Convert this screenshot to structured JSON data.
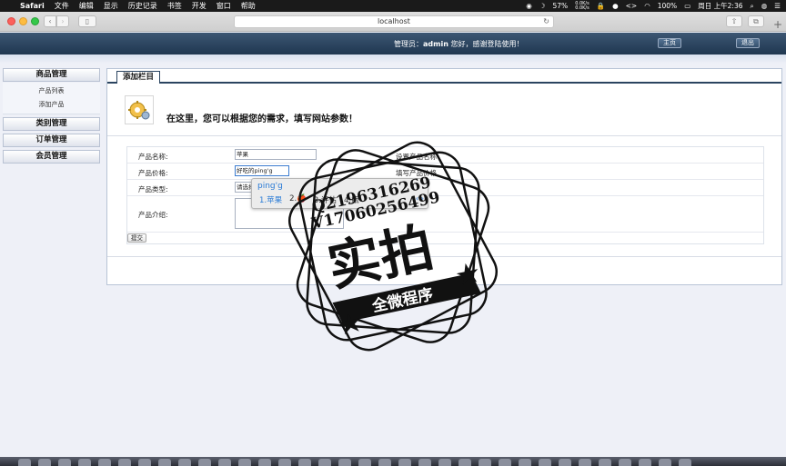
{
  "menubar": {
    "app": "Safari",
    "items": [
      "文件",
      "编辑",
      "显示",
      "历史记录",
      "书签",
      "开发",
      "窗口",
      "帮助"
    ],
    "battery_pct": "57%",
    "net_up": "0.0K/s",
    "net_down": "0.0K/s",
    "battery_full": "100%",
    "datetime": "周日 上午2:36"
  },
  "browser": {
    "url": "localhost"
  },
  "header": {
    "admin_prefix": "管理员：",
    "admin_name": "admin",
    "welcome_suffix": " 您好，感谢登陆使用！",
    "home_label": "主页",
    "logout_label": "退出"
  },
  "sidebar": {
    "groups": [
      {
        "label": "商品管理",
        "items": [
          "产品列表",
          "添加产品"
        ]
      },
      {
        "label": "类别管理"
      },
      {
        "label": "订单管理"
      },
      {
        "label": "会员管理"
      }
    ]
  },
  "main": {
    "tab_title": "添加栏目",
    "intro": "在这里，您可以根据您的需求，填写网站参数！",
    "form": {
      "name_label": "产品名称:",
      "name_value": "苹果",
      "name_hint": "设置产品名称",
      "price_label": "产品价格:",
      "price_value": "好吃的ping'g",
      "price_hint": "填写产品价格",
      "type_label": "产品类型:",
      "type_value": "请选择",
      "type_hint": "型",
      "desc_label": "产品介绍:",
      "submit_label": "提交"
    }
  },
  "ime": {
    "pinyin": "ping'g",
    "candidates": [
      "1.苹果",
      "2.🍎",
      "3.评估",
      "4.瓶"
    ],
    "nav": "‹ ›"
  },
  "watermark": {
    "qq": "Q2196316269",
    "vx": "V17060256499",
    "big_text": "实拍",
    "banner": "全微程序"
  },
  "colors": {
    "header_bg": "#2b4460",
    "accent": "#2a7bd6"
  }
}
